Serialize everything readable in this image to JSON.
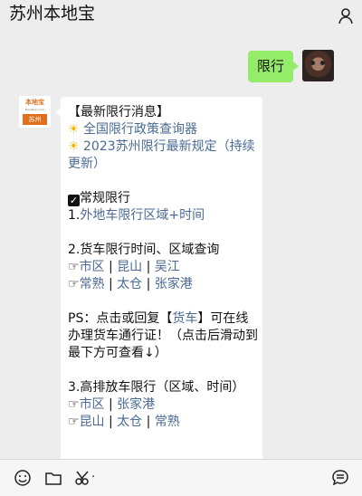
{
  "header": {
    "title": "苏州本地宝",
    "profile_icon": "person-icon"
  },
  "outgoing_message": {
    "text": "限行"
  },
  "incoming_message": {
    "avatar": {
      "top_text": "本地宝",
      "url_text": "Bendibao.com",
      "bottom_text": "苏州"
    },
    "lines": [
      "【最新限行消息】",
      "全国限行政策查询器",
      "2023苏州限行最新规定（持续更新）",
      "常规限行",
      "外地车限行区域+时间",
      "货车限行时间、区域查询",
      "市区",
      "昆山",
      "吴江",
      "常熟",
      "太仓",
      "张家港",
      "PS：点击或回复【",
      "货车",
      "】可在线办理货车通行证！（点击后滑动到最下方可查看↓）",
      "高排放车限行（区域、时间）",
      "市区",
      "张家港",
      "昆山",
      "太仓",
      "常熟"
    ]
  },
  "bottom_toolbar": {
    "emoji_icon": "emoji-icon",
    "folder_icon": "folder-icon",
    "scissors_icon": "scissors-icon",
    "chat_history_icon": "chat-history-icon"
  }
}
